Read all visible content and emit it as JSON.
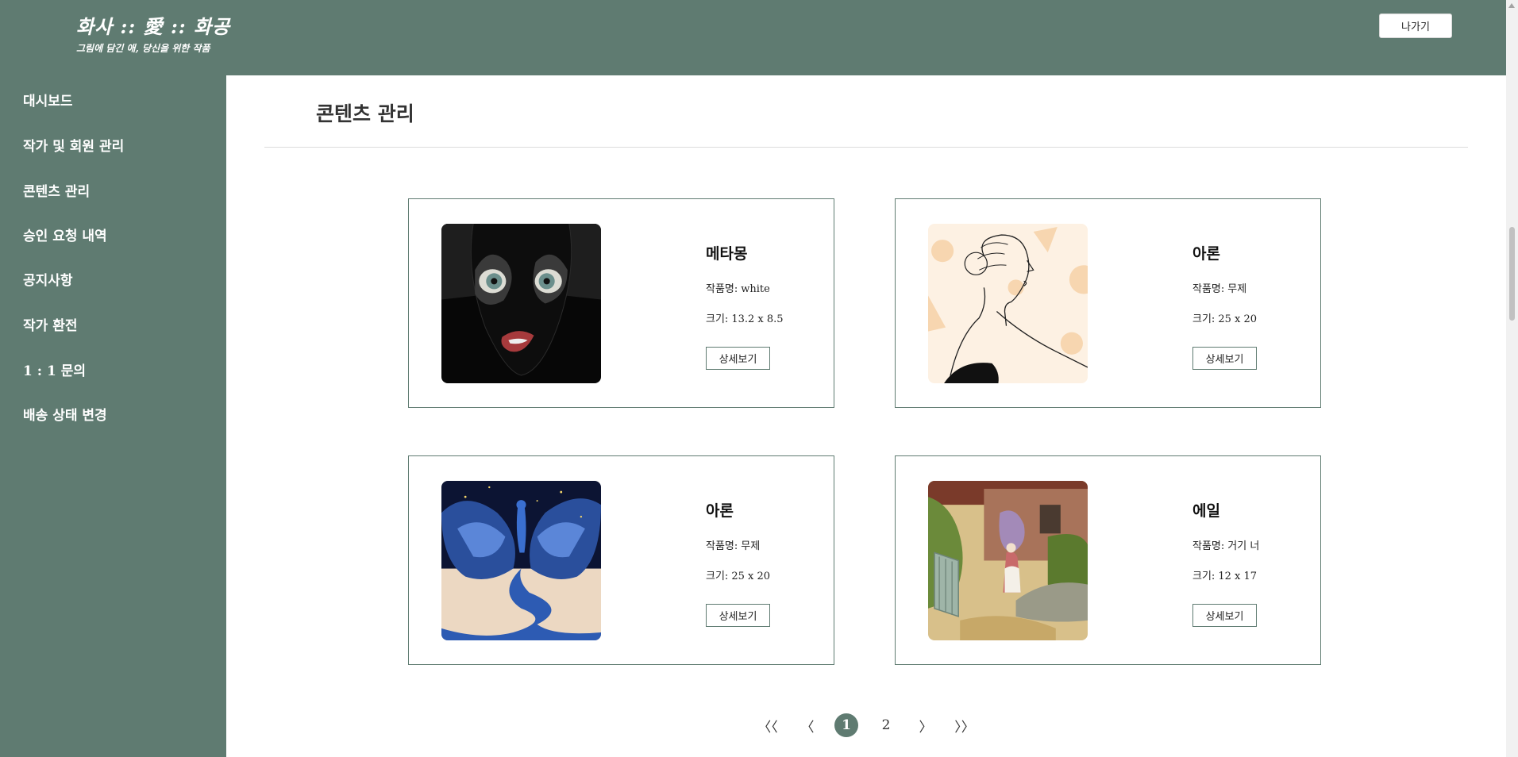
{
  "header": {
    "title": "화사 :: 愛 :: 화공",
    "subtitle": "그림에 담긴 애, 당신을 위한 작품",
    "exit_label": "나가기",
    "bg_color": "#5f7b71"
  },
  "sidebar": {
    "items": [
      {
        "label": "대시보드"
      },
      {
        "label": "작가 및 회원 관리"
      },
      {
        "label": "콘텐츠 관리"
      },
      {
        "label": "승인 요청 내역"
      },
      {
        "label": "공지사항"
      },
      {
        "label": "작가 환전"
      },
      {
        "label": "1 : 1 문의"
      },
      {
        "label": "배송 상태 변경"
      }
    ]
  },
  "main": {
    "title": "콘텐츠 관리"
  },
  "cards": [
    {
      "artist": "메타몽",
      "work_label": "작품명:",
      "work": "white",
      "size_label": "크기:",
      "size": "13.2 x 8.5",
      "detail_label": "상세보기",
      "image": "dark-face-artwork"
    },
    {
      "artist": "아론",
      "work_label": "작품명:",
      "work": "무제",
      "size_label": "크기:",
      "size": "25 x 20",
      "detail_label": "상세보기",
      "image": "woman-line-art"
    },
    {
      "artist": "아론",
      "work_label": "작품명:",
      "work": "무제",
      "size_label": "크기:",
      "size": "25 x 20",
      "detail_label": "상세보기",
      "image": "night-sky-girl-artwork"
    },
    {
      "artist": "에일",
      "work_label": "작품명:",
      "work": "거기 너",
      "size_label": "크기:",
      "size": "12 x 17",
      "detail_label": "상세보기",
      "image": "cottage-garden-painting"
    }
  ],
  "pagination": {
    "first": "〈〈",
    "prev": "〈",
    "pages": [
      "1",
      "2"
    ],
    "current": "1",
    "next": "〉",
    "last": "〉〉"
  }
}
